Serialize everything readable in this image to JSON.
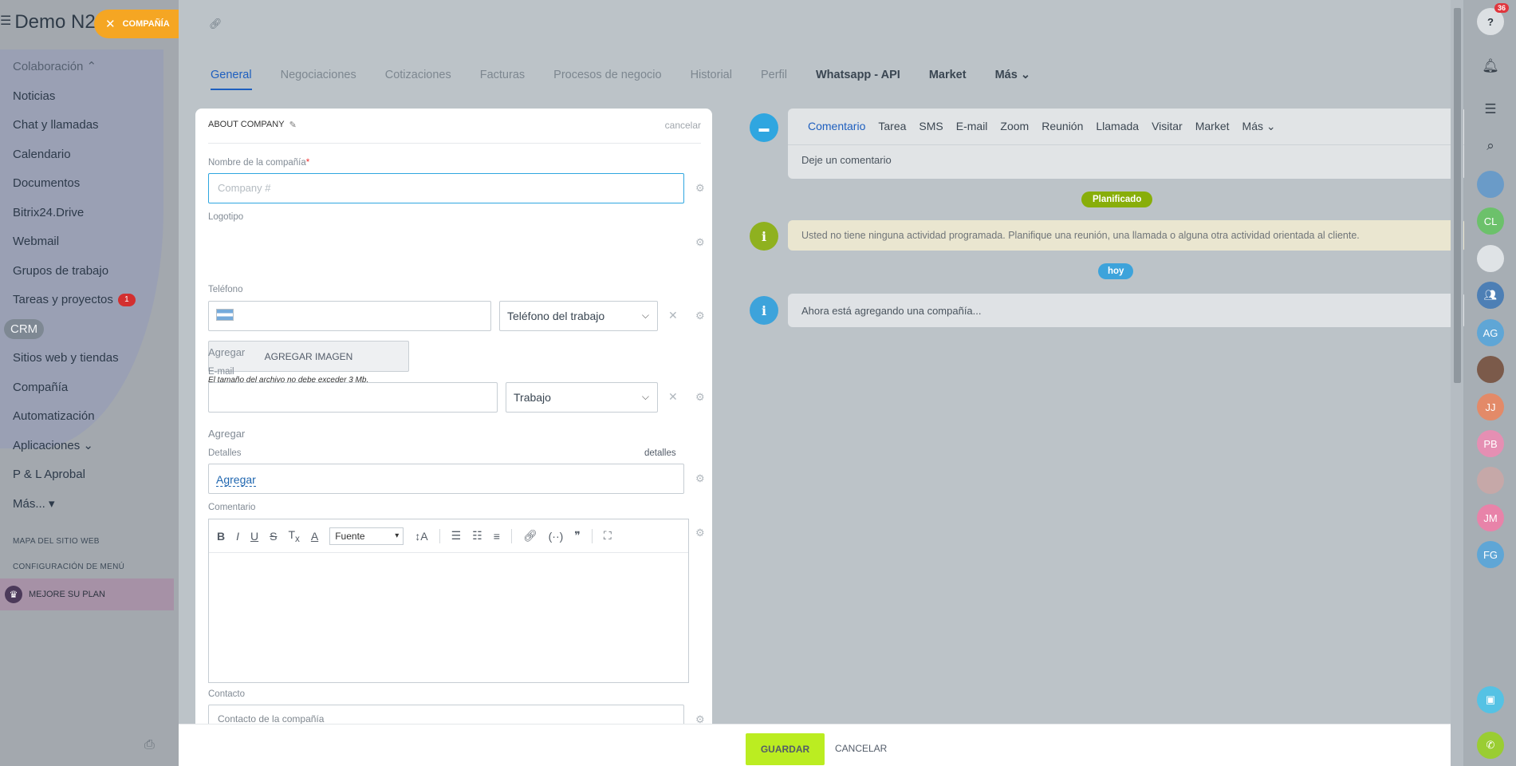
{
  "sidebar": {
    "title": "Demo N2",
    "items": [
      {
        "label": "Colaboración ⌃"
      },
      {
        "label": "Noticias"
      },
      {
        "label": "Chat y llamadas"
      },
      {
        "label": "Calendario"
      },
      {
        "label": "Documentos"
      },
      {
        "label": "Bitrix24.Drive"
      },
      {
        "label": "Webmail"
      },
      {
        "label": "Grupos de trabajo"
      },
      {
        "label": "Tareas y proyectos",
        "badge": "1"
      },
      {
        "label": "CRM"
      },
      {
        "label": "Sitios web y tiendas"
      },
      {
        "label": "Compañía"
      },
      {
        "label": "Automatización"
      },
      {
        "label": "Aplicaciones ⌄"
      },
      {
        "label": "P & L Aprobal"
      },
      {
        "label": "Más... ▾"
      }
    ],
    "sitemap": "MAPA DEL SITIO WEB",
    "menu_config": "CONFIGURACIÓN DE MENÚ",
    "upgrade": "MEJORE SU PLAN"
  },
  "chip": {
    "label": "COMPAÑÍA"
  },
  "tabs": [
    {
      "label": "General"
    },
    {
      "label": "Negociaciones"
    },
    {
      "label": "Cotizaciones"
    },
    {
      "label": "Facturas"
    },
    {
      "label": "Procesos de negocio"
    },
    {
      "label": "Historial"
    },
    {
      "label": "Perfil"
    },
    {
      "label": "Whatsapp - API"
    },
    {
      "label": "Market"
    },
    {
      "label": "Más"
    }
  ],
  "form": {
    "section_title": "ABOUT COMPANY",
    "cancel": "cancelar",
    "company_name_label": "Nombre de la compañía",
    "company_name_placeholder": "Company #",
    "logo_label": "Logotipo",
    "add_image": "AGREGAR IMAGEN",
    "file_hint": "El tamaño del archivo no debe exceder 3 Mb.",
    "phone_label": "Teléfono",
    "phone_type": "Teléfono del trabajo",
    "add": "Agregar",
    "email_label": "E-mail",
    "email_type": "Trabajo",
    "details_label": "Detalles",
    "details_link": "detalles",
    "details_add": "Agregar",
    "comment_label": "Comentario",
    "font_select": "Fuente",
    "contact_label": "Contacto",
    "contact_placeholder": "Contacto de la compañía"
  },
  "timeline": {
    "tabs": [
      "Comentario",
      "Tarea",
      "SMS",
      "E-mail",
      "Zoom",
      "Reunión",
      "Llamada",
      "Visitar",
      "Market",
      "Más ⌄"
    ],
    "leave_comment": "Deje un comentario",
    "planned_badge": "Planificado",
    "no_activity": "Usted no tiene ninguna actividad programada. Planifique una reunión, una llamada o alguna otra actividad orientada al cliente.",
    "today_badge": "hoy",
    "adding_company": "Ahora está agregando una compañía..."
  },
  "footer": {
    "save": "GUARDAR",
    "cancel": "CANCELAR"
  },
  "rail": {
    "help_count": "36",
    "avatars": [
      {
        "initials": "",
        "color": "#6a9bc8"
      },
      {
        "initials": "CL",
        "color": "#6cc16b"
      },
      {
        "initials": "",
        "color": "#dfe3e6"
      },
      {
        "initials": "",
        "color": "#4d7fb5"
      },
      {
        "initials": "AG",
        "color": "#5fa6d6"
      },
      {
        "initials": "",
        "color": "#7b5a4a"
      },
      {
        "initials": "JJ",
        "color": "#e38a68"
      },
      {
        "initials": "PB",
        "color": "#e58fb3"
      },
      {
        "initials": "",
        "color": "#c6a8a8"
      },
      {
        "initials": "JM",
        "color": "#e883a9"
      },
      {
        "initials": "FG",
        "color": "#5fa6d6"
      }
    ]
  }
}
